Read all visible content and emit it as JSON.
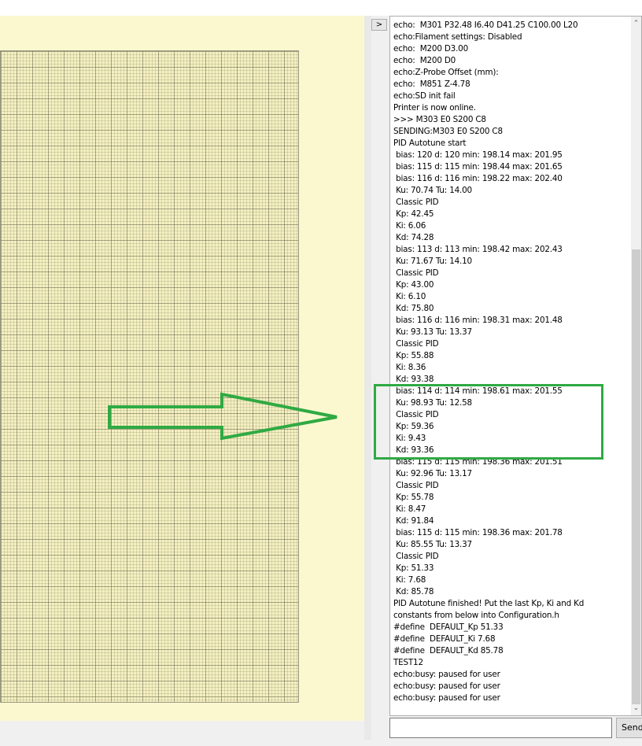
{
  "toolbar": {
    "collapse_label": ">"
  },
  "console": {
    "lines": [
      "echo:  M301 P32.48 I6.40 D41.25 C100.00 L20",
      "echo:Filament settings: Disabled",
      "echo:  M200 D3.00",
      "echo:  M200 D0",
      "echo:Z-Probe Offset (mm):",
      "echo:  M851 Z-4.78",
      "echo:SD init fail",
      "Printer is now online.",
      ">>> M303 E0 S200 C8",
      "SENDING:M303 E0 S200 C8",
      "PID Autotune start",
      " bias: 120 d: 120 min: 198.14 max: 201.95",
      " bias: 115 d: 115 min: 198.44 max: 201.65",
      " bias: 116 d: 116 min: 198.22 max: 202.40",
      " Ku: 70.74 Tu: 14.00",
      " Classic PID",
      " Kp: 42.45",
      " Ki: 6.06",
      " Kd: 74.28",
      " bias: 113 d: 113 min: 198.42 max: 202.43",
      " Ku: 71.67 Tu: 14.10",
      " Classic PID",
      " Kp: 43.00",
      " Ki: 6.10",
      " Kd: 75.80",
      " bias: 116 d: 116 min: 198.31 max: 201.48",
      " Ku: 93.13 Tu: 13.37",
      " Classic PID",
      " Kp: 55.88",
      " Ki: 8.36",
      " Kd: 93.38",
      " bias: 114 d: 114 min: 198.61 max: 201.55",
      " Ku: 98.93 Tu: 12.58",
      " Classic PID",
      " Kp: 59.36",
      " Ki: 9.43",
      " Kd: 93.36",
      " bias: 115 d: 115 min: 198.36 max: 201.51",
      " Ku: 92.96 Tu: 13.17",
      " Classic PID",
      " Kp: 55.78",
      " Ki: 8.47",
      " Kd: 91.84",
      " bias: 115 d: 115 min: 198.36 max: 201.78",
      " Ku: 85.55 Tu: 13.37",
      " Classic PID",
      " Kp: 51.33",
      " Ki: 7.68",
      " Kd: 85.78",
      "PID Autotune finished! Put the last Kp, Ki and Kd",
      "constants from below into Configuration.h",
      "#define  DEFAULT_Kp 51.33",
      "#define  DEFAULT_Ki 7.68",
      "#define  DEFAULT_Kd 85.78",
      "TEST12",
      "echo:busy: paused for user",
      "echo:busy: paused for user",
      "echo:busy: paused for user"
    ]
  },
  "input": {
    "value": ""
  },
  "send_button": {
    "label": "Send"
  },
  "colors": {
    "highlight": "#2faa43",
    "plot_background": "#fbf8cf",
    "grid_line": "#8c8c6e"
  },
  "icons": {
    "scroll_up": "chevron-up-icon",
    "scroll_down": "chevron-down-icon",
    "annotation_arrow": "arrow-right-icon"
  }
}
